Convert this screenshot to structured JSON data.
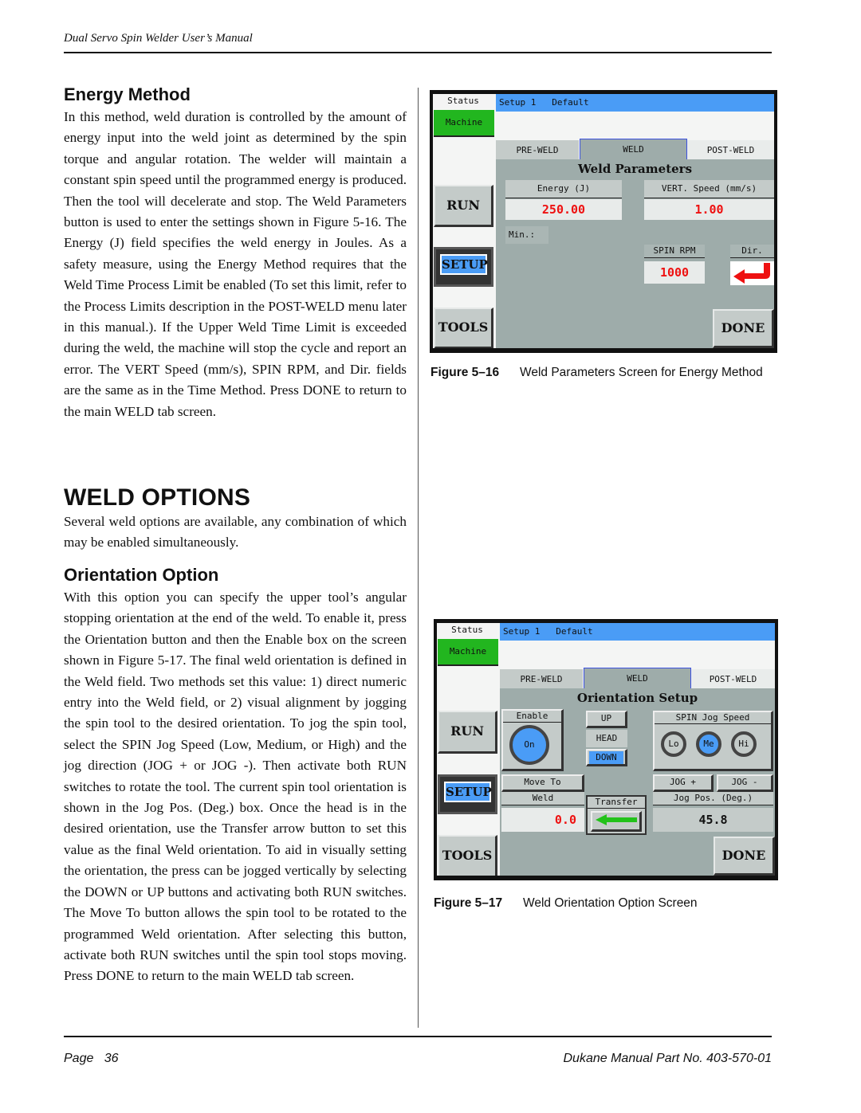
{
  "header": {
    "title": "Dual Servo Spin Welder User’s Manual"
  },
  "energy_method": {
    "heading": "Energy Method",
    "paragraph": "In this method, weld duration is controlled by the amount of energy input into the weld joint as determined by the spin torque and angular rotation. The welder will maintain a constant spin speed until the programmed energy is produced. Then the tool will decelerate and stop. The Weld Parameters button is used to enter the settings shown in Figure 5-16. The Energy (J) field specifies the weld energy in Joules. As a safety measure, using the Energy Method requires that the Weld Time Process Limit be enabled (To set this limit, refer to the Process Limits description in the POST-WELD menu later in this manual.). If the Upper Weld Time Limit is exceeded during the weld, the machine will stop the cycle and report an error. The VERT Speed (mm/s), SPIN RPM, and Dir. fields are the same as in the Time Method. Press DONE to return to the main WELD tab screen."
  },
  "weld_options": {
    "heading": "WELD OPTIONS",
    "paragraph": "Several weld options are available, any combination of which may be enabled simultaneously."
  },
  "orientation_option": {
    "heading": "Orientation Option",
    "paragraph": "With this option you can specify the upper tool’s angular stopping orientation at the end of the weld. To enable it, press the Orientation button and then the Enable box on the screen shown in Figure 5-17. The final weld orientation is defined in the Weld field. Two methods set this value: 1) direct numeric entry into the Weld field, or 2) visual alignment by jogging the spin tool to the desired orientation. To jog the spin tool, select the SPIN Jog Speed (Low, Medium, or High) and the jog direction (JOG + or JOG -). Then activate both RUN switches to rotate the tool. The current spin tool orientation is shown in the Jog Pos. (Deg.) box. Once the head is in the desired orientation, use the Transfer arrow button to set this value as the final Weld orientation. To aid in visually setting the orientation, the press can be jogged vertically by selecting the DOWN or UP buttons and activating both RUN switches. The Move To button allows the spin tool to be rotated to the programmed Weld orientation. After selecting this button, activate both RUN switches until the spin tool stops moving. Press DONE to return to the main WELD tab screen."
  },
  "figure16": {
    "caption_label": "Figure 5–16",
    "caption_text": "Weld Parameters Screen for Energy Method",
    "screen": {
      "status": "Status",
      "machine": "Machine",
      "topbar": "Setup 1   Default",
      "tabs": [
        "PRE-WELD",
        "WELD",
        "POST-WELD"
      ],
      "active_tab": "WELD",
      "title": "Weld Parameters",
      "run": "RUN",
      "setup": "SETUP",
      "tools": "TOOLS",
      "done": "DONE",
      "energy_label": "Energy (J)",
      "energy_value": "250.00",
      "vert_label": "VERT. Speed (mm/s)",
      "vert_value": "1.00",
      "min_label": "Min.:",
      "spin_label": "SPIN RPM",
      "spin_value": "1000",
      "dir_label": "Dir.",
      "dir_icon": "curved-arrow-left-icon"
    }
  },
  "figure17": {
    "caption_label": "Figure 5–17",
    "caption_text": "Weld Orientation Option Screen",
    "screen": {
      "status": "Status",
      "machine": "Machine",
      "topbar": "Setup 1   Default",
      "tabs": [
        "PRE-WELD",
        "WELD",
        "POST-WELD"
      ],
      "active_tab": "WELD",
      "title": "Orientation Setup",
      "run": "RUN",
      "setup": "SETUP",
      "tools": "TOOLS",
      "done": "DONE",
      "enable_label": "Enable",
      "enable_value": "On",
      "up": "UP",
      "head": "HEAD",
      "down": "DOWN",
      "jog_speed_label": "SPIN Jog Speed",
      "jog_speeds": [
        "Lo",
        "Me",
        "Hi"
      ],
      "jog_speed_selected": "Me",
      "move_to": "Move To",
      "weld_label": "Weld",
      "weld_value": "0.0",
      "transfer_label": "Transfer",
      "transfer_icon": "arrow-left-icon",
      "jog_plus": "JOG +",
      "jog_minus": "JOG -",
      "jog_pos_label": "Jog Pos. (Deg.)",
      "jog_pos_value": "45.8"
    }
  },
  "footer": {
    "page": "Page   36",
    "part_no": "Dukane Manual Part No. 403-570-01"
  },
  "colors": {
    "hmi_blue": "#4a9cf6",
    "hmi_green": "#22b61f",
    "hmi_panel": "#9eacaa",
    "value_red": "#ee1111"
  }
}
